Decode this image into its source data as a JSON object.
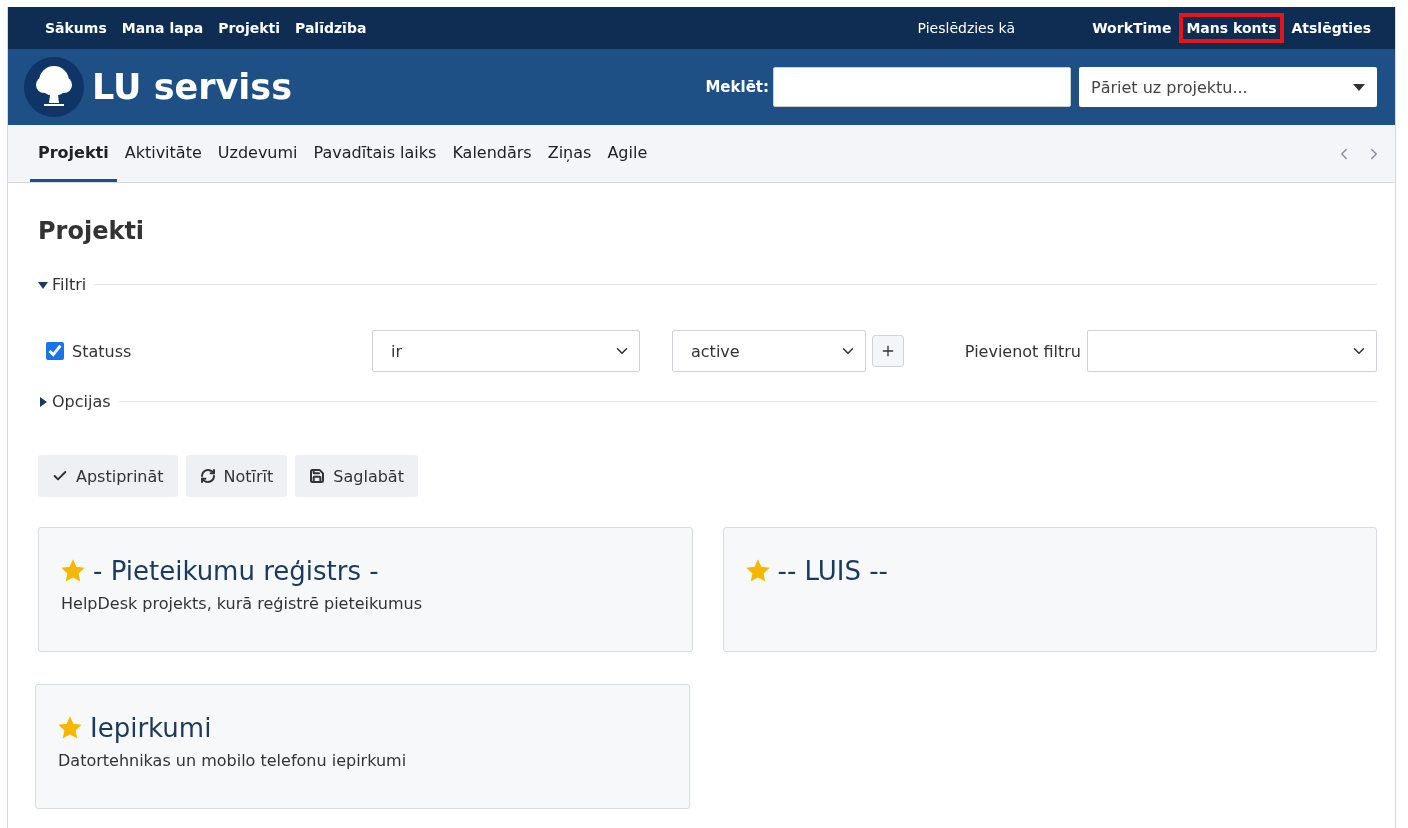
{
  "top_menu": {
    "left": [
      {
        "label": "Sākums",
        "highlighted": false
      },
      {
        "label": "Mana lapa",
        "highlighted": false
      },
      {
        "label": "Projekti",
        "highlighted": false
      },
      {
        "label": "Palīdzība",
        "highlighted": false
      }
    ],
    "logged_in_as": "Pieslēdzies kā",
    "right": [
      {
        "label": "WorkTime",
        "highlighted": false
      },
      {
        "label": "Mans konts",
        "highlighted": true
      },
      {
        "label": "Atslēgties",
        "highlighted": false
      }
    ]
  },
  "header": {
    "title": "LU serviss",
    "search_label": "Meklēt:",
    "project_jump": {
      "placeholder": "Pāriet uz projektu..."
    }
  },
  "tabs": [
    {
      "label": "Projekti",
      "selected": true
    },
    {
      "label": "Aktivitāte",
      "selected": false
    },
    {
      "label": "Uzdevumi",
      "selected": false
    },
    {
      "label": "Pavadītais laiks",
      "selected": false
    },
    {
      "label": "Kalendārs",
      "selected": false
    },
    {
      "label": "Ziņas",
      "selected": false
    },
    {
      "label": "Agile",
      "selected": false
    }
  ],
  "page_title": "Projekti",
  "filters": {
    "title": "Filtri",
    "expanded": true,
    "rows": [
      {
        "label": "Statuss",
        "checked": true,
        "operator": "ir",
        "value": "active"
      }
    ],
    "add_filter_label": "Pievienot filtru"
  },
  "options": {
    "title": "Opcijas",
    "expanded": false
  },
  "buttons": [
    {
      "kind": "apply",
      "label": "Apstiprināt"
    },
    {
      "kind": "clear",
      "label": "Notīrīt"
    },
    {
      "kind": "save",
      "label": "Saglabāt"
    }
  ],
  "projects": [
    {
      "name": "- Pieteikumu reģistrs -",
      "description": "HelpDesk projekts, kurā reģistrē pieteikumus",
      "starred": true
    },
    {
      "name": "-- LUIS --",
      "starred": true
    },
    {
      "name": "Iepirkumi",
      "description": "Datortehnikas un mobilo telefonu iepirkumi",
      "starred": true
    }
  ]
}
